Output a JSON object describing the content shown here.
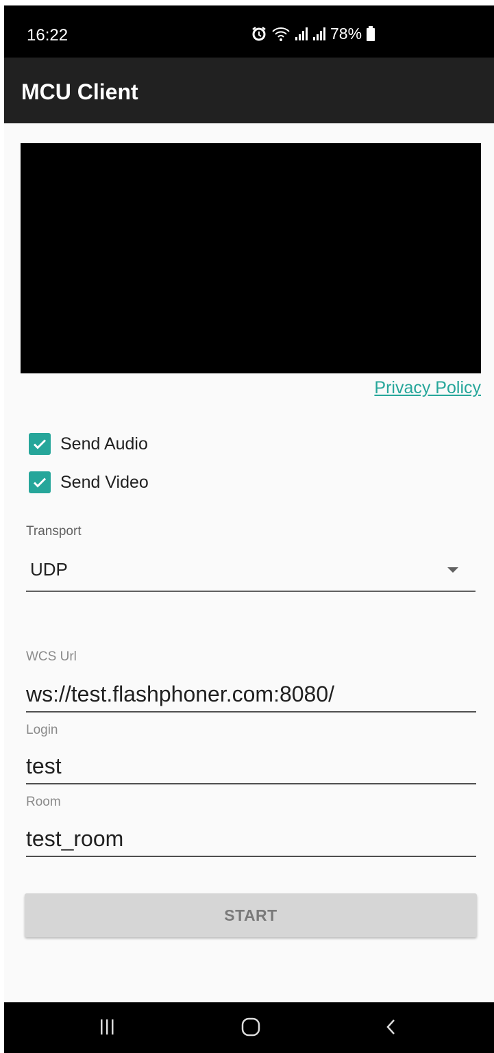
{
  "status_bar": {
    "time": "16:22",
    "battery": "78%",
    "icons": [
      "alarm-icon",
      "wifi-icon",
      "signal-icon",
      "signal-icon",
      "battery-icon"
    ]
  },
  "app_bar": {
    "title": "MCU Client"
  },
  "video": {
    "background": "#000000"
  },
  "privacy_link": "Privacy Policy",
  "checkboxes": [
    {
      "label": "Send Audio",
      "checked": true
    },
    {
      "label": "Send Video",
      "checked": true
    }
  ],
  "transport": {
    "label": "Transport",
    "value": "UDP"
  },
  "fields": {
    "wcs_url": {
      "label": "WCS Url",
      "value": "ws://test.flashphoner.com:8080/"
    },
    "login": {
      "label": "Login",
      "value": "test"
    },
    "room": {
      "label": "Room",
      "value": "test_room"
    }
  },
  "start_button": "START",
  "nav_bar": {
    "buttons": [
      "recent-apps-icon",
      "home-icon",
      "back-icon"
    ]
  },
  "colors": {
    "accent": "#26a69a",
    "app_bar": "#212121",
    "status_bar": "#000000"
  }
}
